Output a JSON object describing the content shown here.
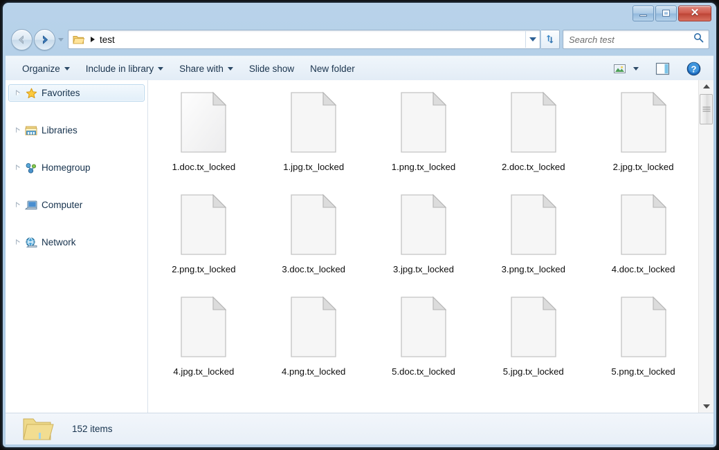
{
  "window": {
    "controls": {
      "minimize": "Minimize",
      "maximize": "Maximize",
      "close": "✕"
    }
  },
  "nav": {
    "back_label": "Back",
    "forward_label": "Forward",
    "recent_pages_label": "Recent pages",
    "address": {
      "folder_icon": "folder-icon",
      "separator": "▶",
      "path": "test",
      "dropdown_label": "Previous locations"
    },
    "refresh_label": "Refresh"
  },
  "search": {
    "placeholder": "Search test",
    "icon": "search-icon"
  },
  "toolbar": {
    "items": [
      {
        "label": "Organize",
        "has_caret": true
      },
      {
        "label": "Include in library",
        "has_caret": true
      },
      {
        "label": "Share with",
        "has_caret": true
      },
      {
        "label": "Slide show",
        "has_caret": false
      },
      {
        "label": "New folder",
        "has_caret": false
      }
    ],
    "right_icons": [
      {
        "name": "change-view-icon",
        "label": "Change your view"
      },
      {
        "name": "chevron-down-icon",
        "label": "More options"
      },
      {
        "name": "preview-pane-icon",
        "label": "Show the preview pane"
      },
      {
        "name": "help-icon",
        "label": "Get help"
      }
    ]
  },
  "sidebar": {
    "items": [
      {
        "label": "Favorites",
        "icon": "star-icon",
        "selected": true
      },
      {
        "label": "Libraries",
        "icon": "libraries-icon",
        "selected": false
      },
      {
        "label": "Homegroup",
        "icon": "homegroup-icon",
        "selected": false
      },
      {
        "label": "Computer",
        "icon": "computer-icon",
        "selected": false
      },
      {
        "label": "Network",
        "icon": "network-icon",
        "selected": false
      }
    ]
  },
  "files": [
    {
      "name": "1.doc.tx_locked",
      "icon": "blank-file-icon"
    },
    {
      "name": "1.jpg.tx_locked",
      "icon": "blank-file-icon"
    },
    {
      "name": "1.png.tx_locked",
      "icon": "blank-file-icon"
    },
    {
      "name": "2.doc.tx_locked",
      "icon": "blank-file-icon"
    },
    {
      "name": "2.jpg.tx_locked",
      "icon": "blank-file-icon"
    },
    {
      "name": "2.png.tx_locked",
      "icon": "blank-file-icon"
    },
    {
      "name": "3.doc.tx_locked",
      "icon": "blank-file-icon"
    },
    {
      "name": "3.jpg.tx_locked",
      "icon": "blank-file-icon"
    },
    {
      "name": "3.png.tx_locked",
      "icon": "blank-file-icon"
    },
    {
      "name": "4.doc.tx_locked",
      "icon": "blank-file-icon"
    },
    {
      "name": "4.jpg.tx_locked",
      "icon": "blank-file-icon"
    },
    {
      "name": "4.png.tx_locked",
      "icon": "blank-file-icon"
    },
    {
      "name": "5.doc.tx_locked",
      "icon": "blank-file-icon"
    },
    {
      "name": "5.jpg.tx_locked",
      "icon": "blank-file-icon"
    },
    {
      "name": "5.png.tx_locked",
      "icon": "blank-file-icon"
    }
  ],
  "status": {
    "icon": "folder-icon",
    "item_count": "152 items"
  },
  "colors": {
    "frame": "#a8c8e4",
    "close_button": "#c0412f",
    "selection": "#e2eff9",
    "text": "#15314c",
    "toolbar_bg": "#e6eff7"
  }
}
